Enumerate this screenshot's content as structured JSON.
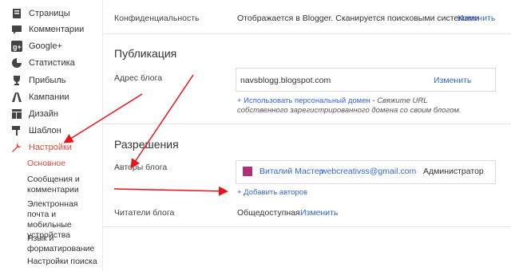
{
  "sidebar": {
    "items": [
      {
        "label": "Страницы",
        "icon": "page-icon"
      },
      {
        "label": "Комментарии",
        "icon": "comment-icon"
      },
      {
        "label": "Google+",
        "icon": "google-plus-icon"
      },
      {
        "label": "Статистика",
        "icon": "stats-pie-icon"
      },
      {
        "label": "Прибыль",
        "icon": "trophy-icon"
      },
      {
        "label": "Кампании",
        "icon": "campaign-icon"
      },
      {
        "label": "Дизайн",
        "icon": "layout-icon"
      },
      {
        "label": "Шаблон",
        "icon": "template-icon"
      },
      {
        "label": "Настройки",
        "icon": "wrench-icon"
      }
    ],
    "subitems": [
      "Основное",
      "Сообщения и комментарии",
      "Электронная почта и мобильные устройства",
      "Язык и форматирование",
      "Настройки поиска"
    ],
    "accent_color": "#dd4b39"
  },
  "privacy": {
    "label": "Конфиденциальность",
    "value": "Отображается в Blogger. Сканируется поисковыми системами",
    "change": "Изменить"
  },
  "publication": {
    "title": "Публикация",
    "address_label": "Адрес блога",
    "address_value": "navsblogg.blogspot.com",
    "change": "Изменить",
    "custom_domain_link": "+ Использовать персональный домен",
    "custom_domain_hint": " - Свяжите URL собственного зарегистрированного домена со своим блогом."
  },
  "permissions": {
    "title": "Разрешения",
    "authors_label": "Авторы блога",
    "author_name": "Виталий Мастер",
    "author_email": "webcreativss@gmail.com",
    "author_role": "Администратор",
    "add_authors": "+ Добавить авторов",
    "readers_label": "Читатели блога",
    "readers_value": "Общедоступная",
    "readers_change": "Изменить"
  },
  "annotation_color": "#e8141b",
  "link_color": "#3367d6"
}
